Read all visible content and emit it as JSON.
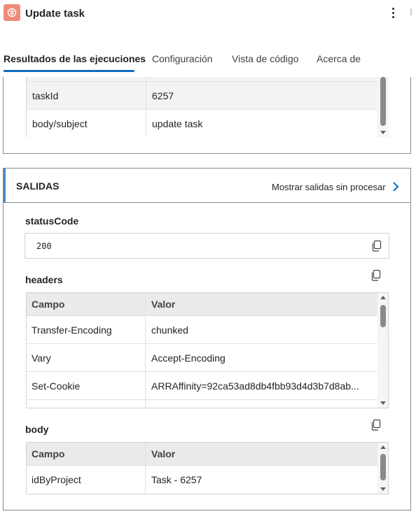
{
  "header": {
    "title": "Update task",
    "icon": "brain-icon"
  },
  "tabs": [
    {
      "label": "Resultados de las ejecuciones",
      "active": true
    },
    {
      "label": "Configuración"
    },
    {
      "label": "Vista de código"
    },
    {
      "label": "Acerca de"
    }
  ],
  "inputs_table": {
    "rows": [
      {
        "field": "taskId",
        "value": "6257"
      },
      {
        "field": "body/subject",
        "value": "update task"
      }
    ]
  },
  "outputs": {
    "title": "SALIDAS",
    "raw_link": "Mostrar salidas sin procesar",
    "status_code": {
      "label": "statusCode",
      "value": "200"
    },
    "headers": {
      "label": "headers",
      "columns": [
        "Campo",
        "Valor"
      ],
      "rows": [
        {
          "field": "Transfer-Encoding",
          "value": "chunked"
        },
        {
          "field": "Vary",
          "value": "Accept-Encoding"
        },
        {
          "field": "Set-Cookie",
          "value": "ARRAffinity=92ca53ad8db4fbb93d4d3b7d8ab..."
        }
      ]
    },
    "body": {
      "label": "body",
      "columns": [
        "Campo",
        "Valor"
      ],
      "rows": [
        {
          "field": "idByProject",
          "value": "Task - 6257"
        }
      ]
    }
  },
  "colors": {
    "accent": "#0f6cbd",
    "icon_bg": "#f08a7a",
    "section_bar": "#4a8ac8"
  }
}
